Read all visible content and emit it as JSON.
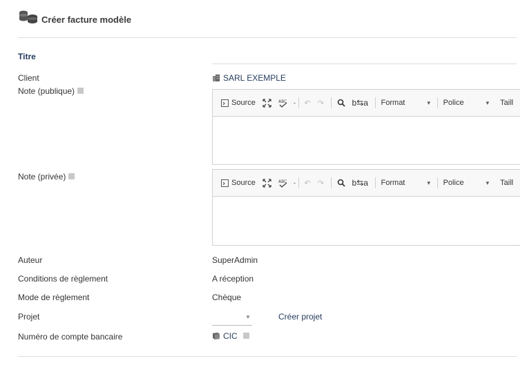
{
  "header": {
    "title": "Créer facture modèle",
    "logo_icon": "coins-icon"
  },
  "form": {
    "titre_label": "Titre",
    "client_label": "Client",
    "client_value": "SARL EXEMPLE",
    "note_public_label": "Note (publique)",
    "note_private_label": "Note (privée)",
    "auteur_label": "Auteur",
    "auteur_value": "SuperAdmin",
    "conditions_label": "Conditions de règlement",
    "conditions_value": "A réception",
    "mode_label": "Mode de règlement",
    "mode_value": "Chèque",
    "projet_label": "Projet",
    "create_project": "Créer projet",
    "bank_label": "Numéro de compte bancaire",
    "bank_value": "CIC"
  },
  "editor": {
    "source": "Source",
    "format": "Format",
    "police": "Police",
    "taille": "Taill"
  }
}
